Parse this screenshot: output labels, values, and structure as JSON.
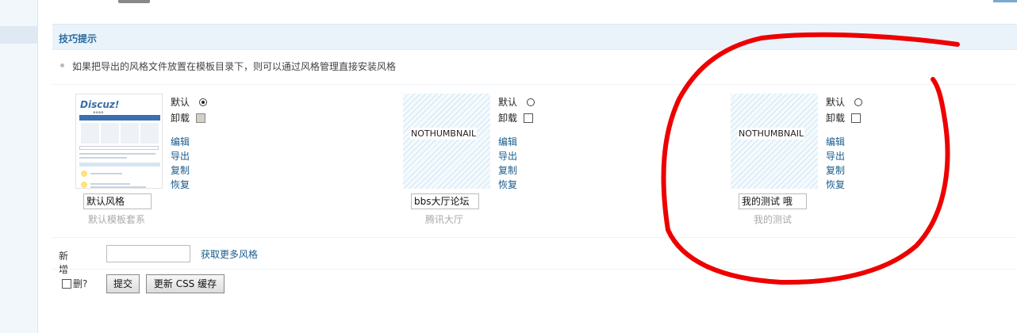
{
  "tips": {
    "title": "技巧提示",
    "text": "如果把导出的风格文件放置在模板目录下，则可以通过风格管理直接安装风格"
  },
  "styles": [
    {
      "thumbnail": "discuz-screenshot",
      "thumbnail_label": "",
      "default_label": "默认",
      "default_selected": true,
      "uninstall_label": "卸载",
      "uninstall_disabled": true,
      "actions": [
        "编辑",
        "导出",
        "复制",
        "恢复"
      ],
      "name_value": "默认风格",
      "subtitle": "默认模板套系"
    },
    {
      "thumbnail": "none",
      "thumbnail_label": "NOTHUMBNAIL",
      "default_label": "默认",
      "default_selected": false,
      "uninstall_label": "卸载",
      "uninstall_disabled": false,
      "actions": [
        "编辑",
        "导出",
        "复制",
        "恢复"
      ],
      "name_value": "bbs大厅论坛",
      "subtitle": "腾讯大厅"
    },
    {
      "thumbnail": "none",
      "thumbnail_label": "NOTHUMBNAIL",
      "default_label": "默认",
      "default_selected": false,
      "uninstall_label": "卸载",
      "uninstall_disabled": false,
      "actions": [
        "编辑",
        "导出",
        "复制",
        "恢复"
      ],
      "name_value": "我的测试 哦",
      "subtitle": "我的测试"
    }
  ],
  "add": {
    "label": "新增",
    "value": "",
    "more_link": "获取更多风格"
  },
  "footer": {
    "delete_label": "删?",
    "submit_label": "提交",
    "update_css_label": "更新 CSS 缓存"
  },
  "colors": {
    "link": "#1a5c8e",
    "annotation": "#ee0000"
  }
}
